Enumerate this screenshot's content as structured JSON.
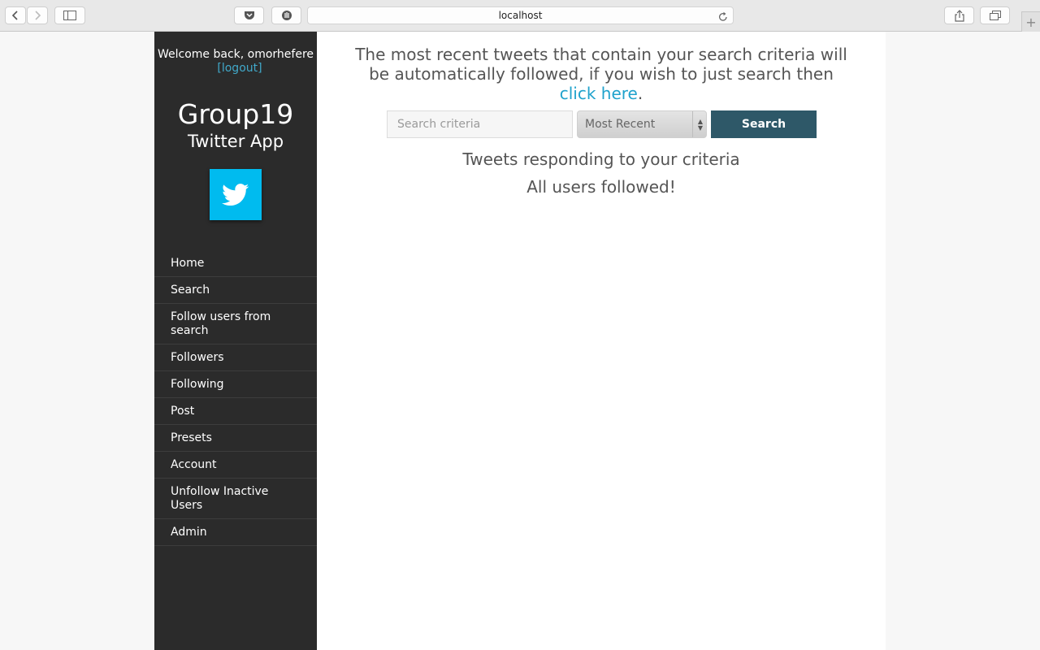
{
  "browser": {
    "url": "localhost",
    "new_tab_label": "+"
  },
  "sidebar": {
    "welcome": "Welcome back, omorhefere",
    "logout": "[logout]",
    "brand_title": "Group19",
    "brand_subtitle": "Twitter App",
    "nav": [
      {
        "label": "Home"
      },
      {
        "label": "Search"
      },
      {
        "label": "Follow users from search"
      },
      {
        "label": "Followers"
      },
      {
        "label": "Following"
      },
      {
        "label": "Post"
      },
      {
        "label": "Presets"
      },
      {
        "label": "Account"
      },
      {
        "label": "Unfollow Inactive Users"
      },
      {
        "label": "Admin"
      }
    ]
  },
  "main": {
    "info_text": "The most recent tweets that contain your search criteria will be automatically followed, if you wish to just search then",
    "info_link": "click here",
    "info_end": ".",
    "search": {
      "placeholder": "Search criteria",
      "value": "",
      "sort_selected": "Most Recent",
      "button": "Search"
    },
    "results_heading": "Tweets responding to your criteria",
    "status": "All users followed!"
  },
  "colors": {
    "sidebar_bg": "#2b2b2b",
    "accent": "#00bbef",
    "link": "#1fa2cc",
    "button": "#2e5868"
  }
}
